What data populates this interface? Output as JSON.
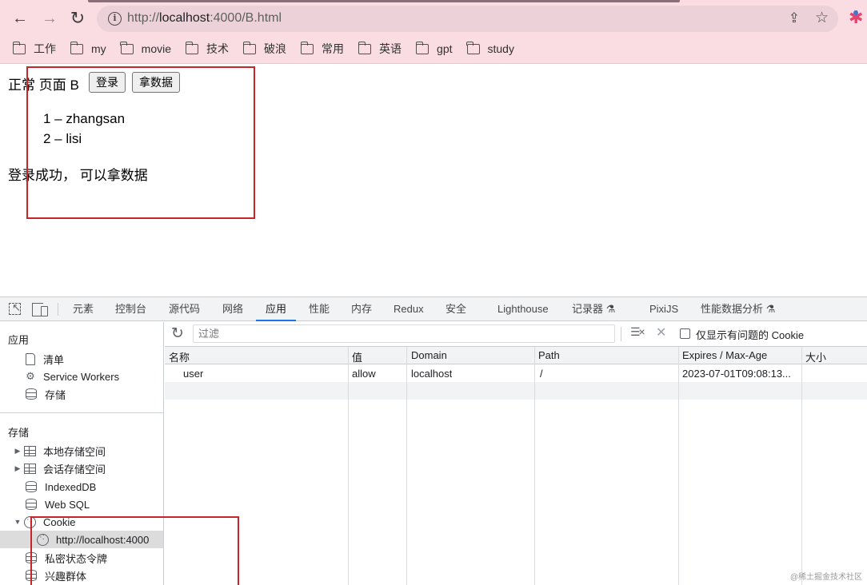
{
  "browser": {
    "url_scheme": "http://",
    "url_host": "localhost",
    "url_rest": ":4000/B.html",
    "bookmarks": [
      "工作",
      "my",
      "movie",
      "技术",
      "破浪",
      "常用",
      "英语",
      "gpt",
      "study"
    ]
  },
  "page": {
    "heading": "正常 页面 B",
    "login_button": "登录",
    "fetch_button": "拿数据",
    "users": [
      "1 – zhangsan",
      "2 – lisi"
    ],
    "status": "登录成功， 可以拿数据"
  },
  "devtools": {
    "tabs": [
      "元素",
      "控制台",
      "源代码",
      "网络",
      "应用",
      "性能",
      "内存",
      "Redux",
      "安全",
      "Lighthouse",
      "记录器 ⚗",
      "PixiJS",
      "性能数据分析 ⚗"
    ],
    "active_tab": "应用",
    "sidebar": {
      "app_section": "应用",
      "app_items": [
        "清单",
        "Service Workers",
        "存储"
      ],
      "storage_section": "存储",
      "storage_items": [
        "本地存储空间",
        "会话存储空间",
        "IndexedDB",
        "Web SQL",
        "Cookie",
        "http://localhost:4000",
        "私密状态令牌",
        "兴趣群体"
      ]
    },
    "cookies": {
      "filter_placeholder": "过滤",
      "only_issues_label": "仅显示有问题的 Cookie",
      "columns": [
        "名称",
        "值",
        "Domain",
        "Path",
        "Expires / Max-Age",
        "大小"
      ],
      "rows": [
        {
          "name": "user",
          "value": "allow",
          "domain": "localhost",
          "path": "/",
          "expires": "2023-07-01T09:08:13...",
          "size": ""
        }
      ]
    }
  },
  "watermark": "@稀土掘金技术社区",
  "colors": {
    "chrome_bg": "#fadde3",
    "annotation_red": "#c8252b",
    "active_tab_underline": "#1a73e8"
  }
}
